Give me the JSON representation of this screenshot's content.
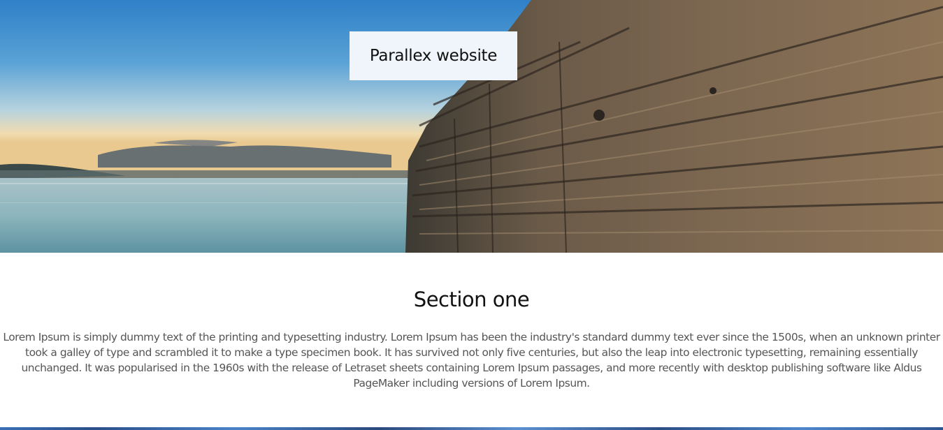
{
  "hero": {
    "title": "Parallex website",
    "image": "seaside-wooden-pier-image",
    "colors": {
      "sky_top": "#3e8ed0",
      "sky_horizon": "#e8dcc0",
      "water": "#8fb9c4",
      "wood": "#6b5442"
    }
  },
  "section_one": {
    "heading": "Section one",
    "body": "Lorem Ipsum is simply dummy text of the printing and typesetting industry. Lorem Ipsum has been the industry's standard dummy text ever since the 1500s, when an unknown printer took a galley of type and scrambled it to make a type specimen book. It has survived not only five centuries, but also the leap into electronic typesetting, remaining essentially unchanged. It was popularised in the 1960s with the release of Letraset sheets containing Lorem Ipsum passages, and more recently with desktop publishing software like Aldus PageMaker including versions of Lorem Ipsum."
  },
  "next_section": {
    "image": "blue-background-image"
  }
}
